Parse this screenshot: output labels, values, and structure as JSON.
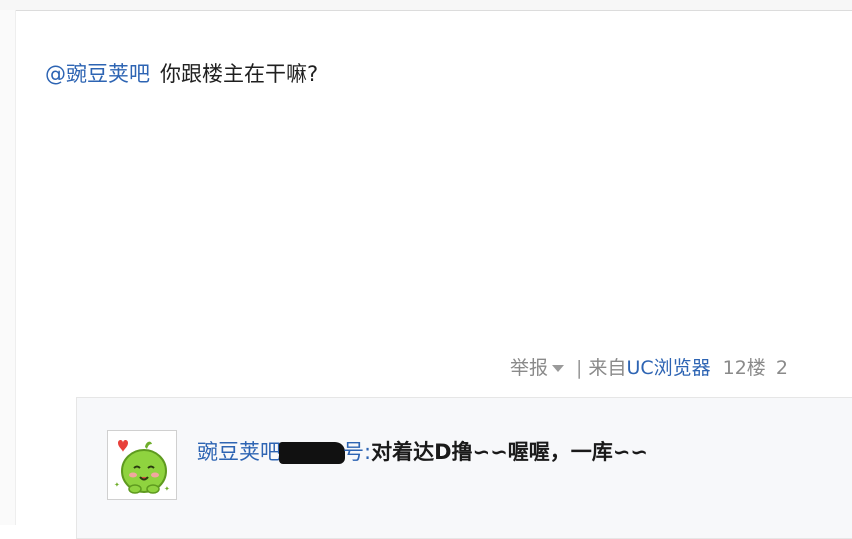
{
  "post": {
    "mention": "@豌豆荚吧",
    "text": "你跟楼主在干嘛?"
  },
  "meta": {
    "report": "举报",
    "separator": "|",
    "source_prefix": "来自",
    "source_link": "UC浏览器",
    "floor": "12楼",
    "date_partial": "2"
  },
  "reply": {
    "user_part1": "豌豆荚吧",
    "user_part2": "号:",
    "text": "对着达D撸∽∽喔喔，一库∽∽"
  },
  "colors": {
    "link": "#2d64b3",
    "meta": "#8a8a8a"
  },
  "icons": {
    "caret": "chevron-down-icon",
    "avatar": "green-pea-mascot"
  }
}
